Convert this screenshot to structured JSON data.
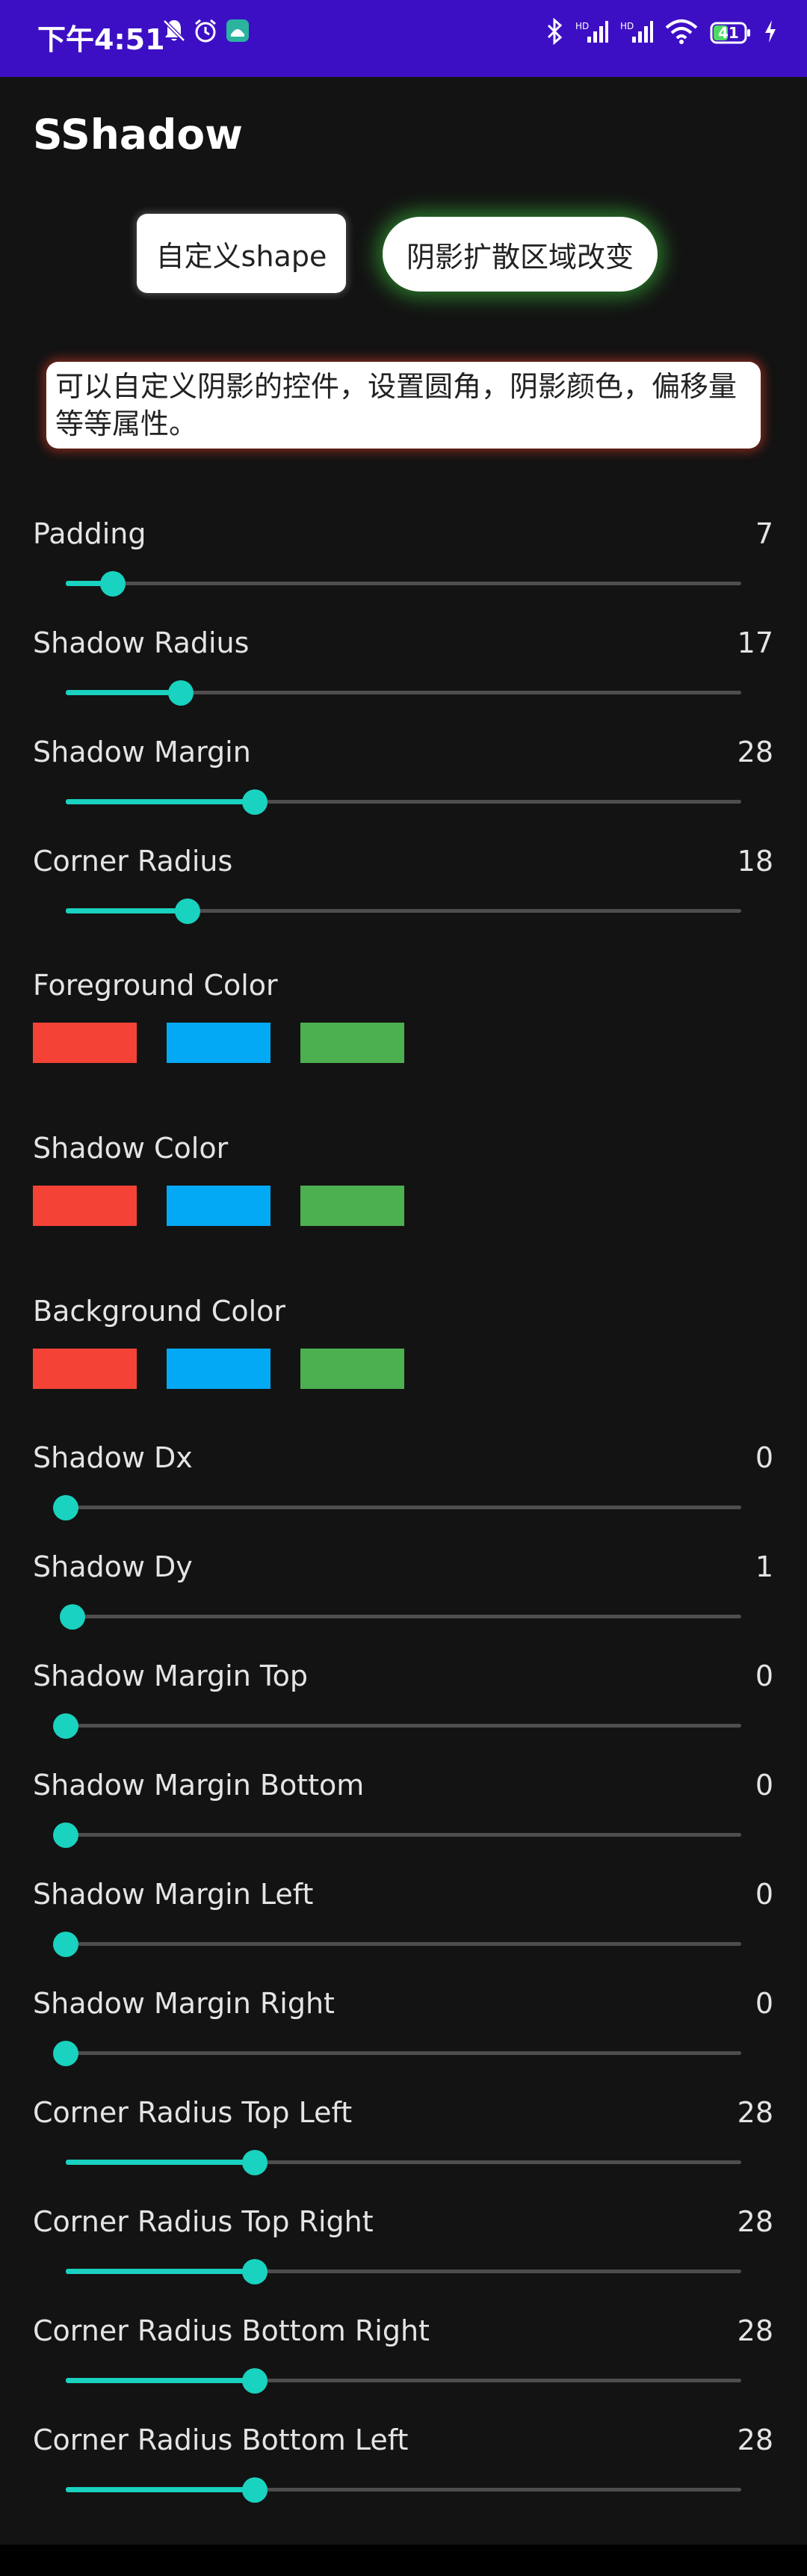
{
  "status_bar": {
    "time": "下午4:51",
    "battery": "41",
    "bg_color": "#3d0fc4"
  },
  "app": {
    "title": "SShadow"
  },
  "buttons": {
    "custom_shape": "自定义shape",
    "spread_change": "阴影扩散区域改变"
  },
  "description": "可以自定义阴影的控件，设置圆角，阴影颜色，偏移量等等属性。",
  "accent_color": "#19d2bf",
  "swatch_colors": [
    "#f44336",
    "#03a9f4",
    "#4caf50"
  ],
  "sliders_group1": [
    {
      "label": "Padding",
      "value": "7",
      "fraction": 0.07
    },
    {
      "label": "Shadow Radius",
      "value": "17",
      "fraction": 0.17
    },
    {
      "label": "Shadow Margin",
      "value": "28",
      "fraction": 0.28
    },
    {
      "label": "Corner Radius",
      "value": "18",
      "fraction": 0.18
    }
  ],
  "color_groups": [
    {
      "label": "Foreground Color"
    },
    {
      "label": "Shadow Color"
    },
    {
      "label": "Background Color"
    }
  ],
  "sliders_group2": [
    {
      "label": "Shadow Dx",
      "value": "0",
      "fraction": 0.0
    },
    {
      "label": "Shadow Dy",
      "value": "1",
      "fraction": 0.01
    },
    {
      "label": "Shadow Margin Top",
      "value": "0",
      "fraction": 0.0
    },
    {
      "label": "Shadow Margin Bottom",
      "value": "0",
      "fraction": 0.0
    },
    {
      "label": "Shadow Margin Left",
      "value": "0",
      "fraction": 0.0
    },
    {
      "label": "Shadow Margin Right",
      "value": "0",
      "fraction": 0.0
    },
    {
      "label": "Corner Radius Top Left",
      "value": "28",
      "fraction": 0.28
    },
    {
      "label": "Corner Radius Top Right",
      "value": "28",
      "fraction": 0.28
    },
    {
      "label": "Corner Radius Bottom Right",
      "value": "28",
      "fraction": 0.28
    },
    {
      "label": "Corner Radius Bottom Left",
      "value": "28",
      "fraction": 0.28
    }
  ]
}
